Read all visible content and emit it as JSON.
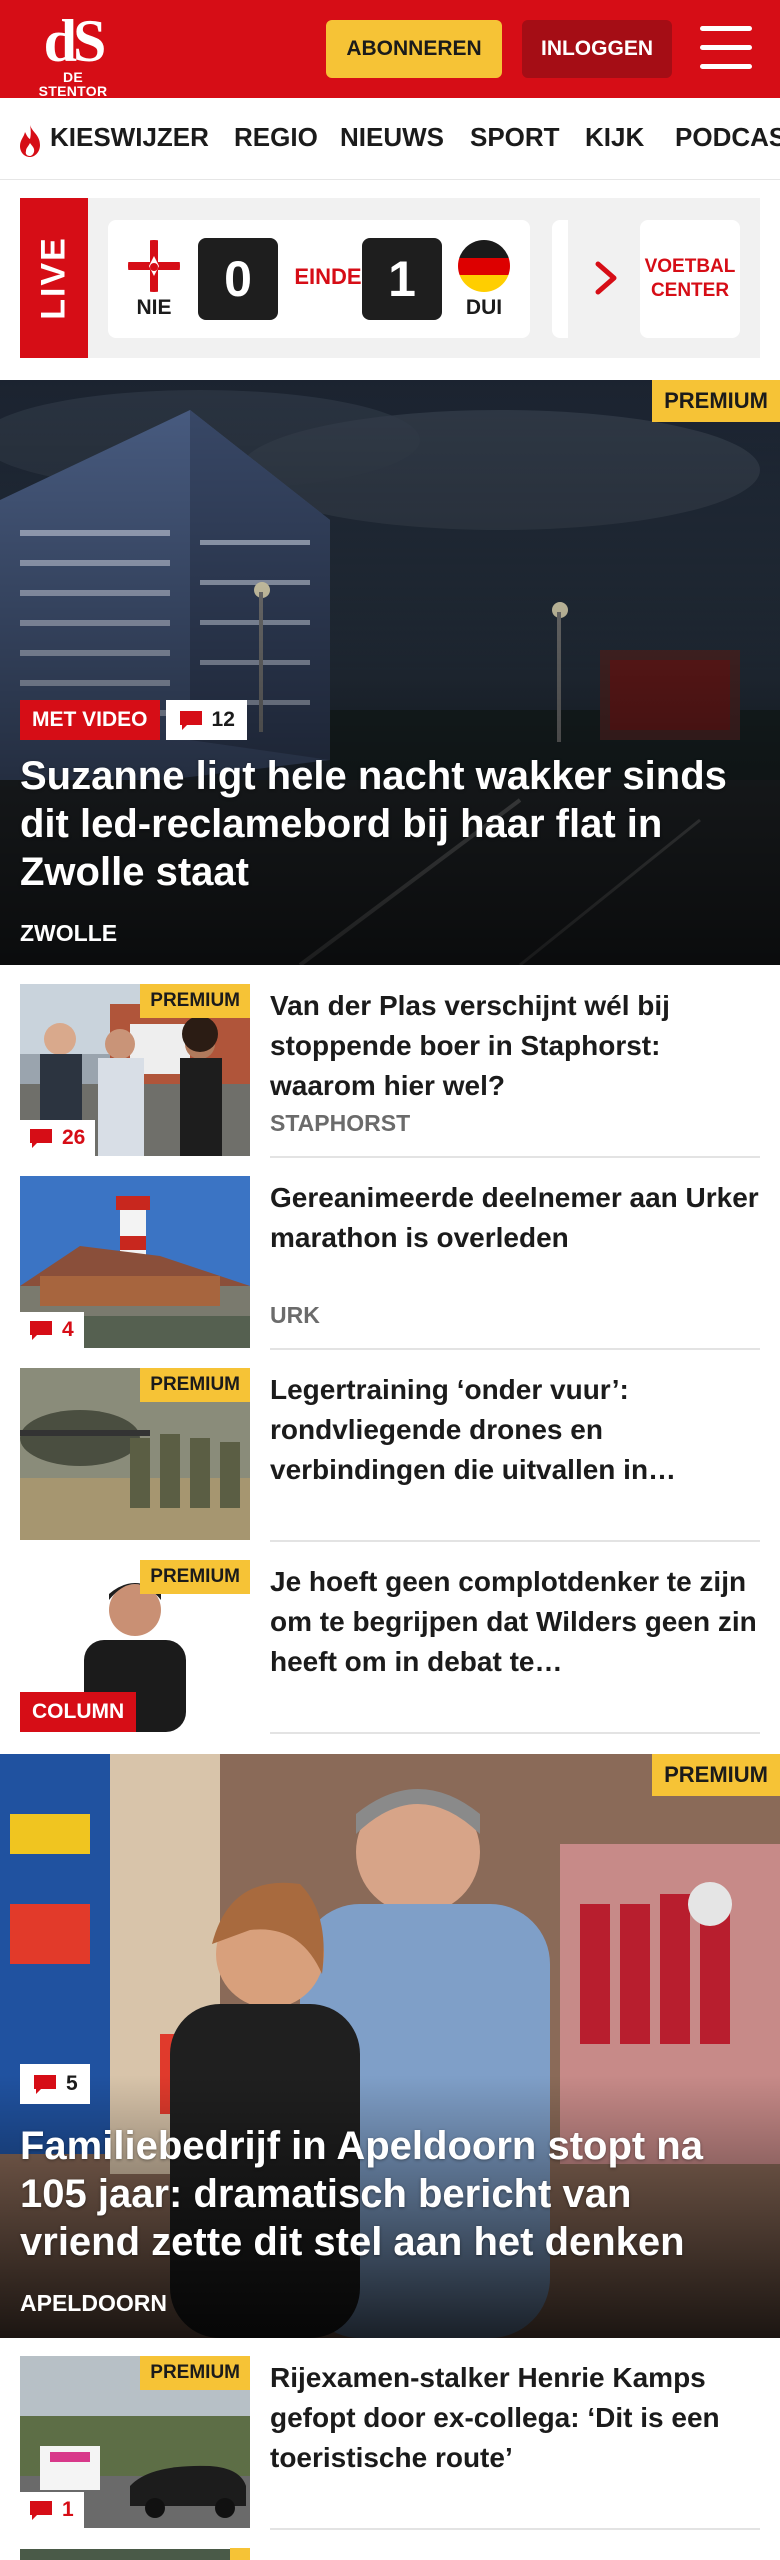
{
  "header": {
    "logo_mark": "dS",
    "logo_sub": "DE STENTOR",
    "subscribe_label": "ABONNEREN",
    "login_label": "INLOGGEN"
  },
  "nav": {
    "items": [
      "KIESWIJZER",
      "REGIO",
      "NIEUWS",
      "SPORT",
      "KIJK",
      "PODCAS"
    ]
  },
  "live": {
    "label": "LIVE",
    "home_team": "NIE",
    "away_team": "DUI",
    "home_score": "0",
    "away_score": "1",
    "status": "EINDE",
    "center_label": "VOETBAL\nCENTER"
  },
  "colors": {
    "brand_red": "#d60d16",
    "premium_yellow": "#f6c336"
  },
  "hero1": {
    "badge": "PREMIUM",
    "video_tag": "MET VIDEO",
    "comments": "12",
    "title": "Suzanne ligt hele nacht wakker sinds dit led-reclamebord bij haar flat in Zwolle staat",
    "location": "ZWOLLE"
  },
  "articles": [
    {
      "title": "Van der Plas verschijnt wél bij stoppende boer in Staphorst: waarom hier wel?",
      "location": "STAPHORST",
      "badge": "PREMIUM",
      "comments": "26"
    },
    {
      "title": "Gereanimeerde deelnemer aan Urker marathon is overleden",
      "location": "URK",
      "comments": "4"
    },
    {
      "title": "Legertraining ‘onder vuur’: rondvliegende drones en verbindingen die uitvallen in…",
      "badge": "PREMIUM"
    },
    {
      "title": "Je hoeft geen complotdenker te zijn om te begrijpen dat Wilders geen zin heeft om in debat te…",
      "badge": "PREMIUM",
      "tag": "COLUMN"
    }
  ],
  "hero2": {
    "badge": "PREMIUM",
    "comments": "5",
    "title": "Familiebedrijf in Apeldoorn stopt na 105 jaar: dramatisch bericht van vriend zette dit stel aan het denken",
    "location": "APELDOORN"
  },
  "article_last": {
    "title": "Rijexamen-stalker Henrie Kamps gefopt door ex-collega: ‘Dit is een toeristische route’",
    "badge": "PREMIUM",
    "comments": "1"
  },
  "article_cut": {
    "badge": "PREMIUM"
  }
}
